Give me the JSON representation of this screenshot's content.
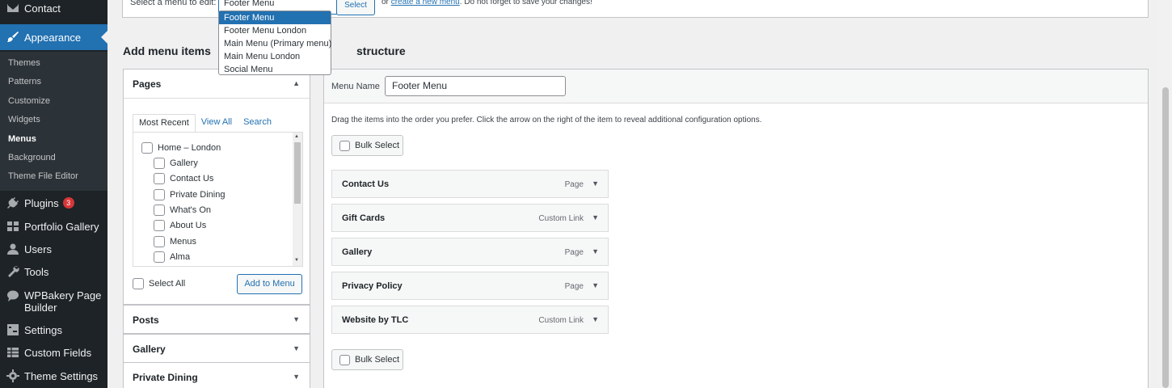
{
  "sidebar": {
    "contact": "Contact",
    "appearance": "Appearance",
    "submenu": [
      "Themes",
      "Patterns",
      "Customize",
      "Widgets",
      "Menus",
      "Background",
      "Theme File Editor"
    ],
    "plugins": "Plugins",
    "plugins_badge": "3",
    "portfolio": "Portfolio Gallery",
    "users": "Users",
    "tools": "Tools",
    "wpbakery_1": "WPBakery Page",
    "wpbakery_2": "Builder",
    "settings": "Settings",
    "custom_fields": "Custom Fields",
    "theme_settings": "Theme Settings"
  },
  "topbar": {
    "label": "Select a menu to edit:",
    "selected": "Footer Menu",
    "select_button": "Select",
    "or_text": "or",
    "create_link": "create a new menu",
    "reminder": ". Do not forget to save your changes!"
  },
  "dropdown_options": [
    "Footer Menu",
    "Footer Menu London",
    "Main Menu (Primary menu)",
    "Main Menu London",
    "Social Menu"
  ],
  "add_items": {
    "heading": "Add menu items",
    "pages_title": "Pages",
    "tabs": [
      "Most Recent",
      "View All",
      "Search"
    ],
    "pages": [
      "Home – London",
      "Gallery",
      "Contact Us",
      "Private Dining",
      "What's On",
      "About Us",
      "Menus",
      "Alma"
    ],
    "select_all": "Select All",
    "add_button": "Add to Menu",
    "accordions": [
      "Posts",
      "Gallery",
      "Private Dining"
    ]
  },
  "structure": {
    "heading": "structure",
    "name_label": "Menu Name",
    "name_value": "Footer Menu",
    "instructions": "Drag the items into the order you prefer. Click the arrow on the right of the item to reveal additional configuration options.",
    "bulk_select": "Bulk Select",
    "items": [
      {
        "title": "Contact Us",
        "kind": "Page"
      },
      {
        "title": "Gift Cards",
        "kind": "Custom Link"
      },
      {
        "title": "Gallery",
        "kind": "Page"
      },
      {
        "title": "Privacy Policy",
        "kind": "Page"
      },
      {
        "title": "Website by TLC",
        "kind": "Custom Link"
      }
    ]
  },
  "colors": {
    "accent": "#2271b1",
    "sidebar": "#1d2327",
    "badge": "#d63638"
  }
}
